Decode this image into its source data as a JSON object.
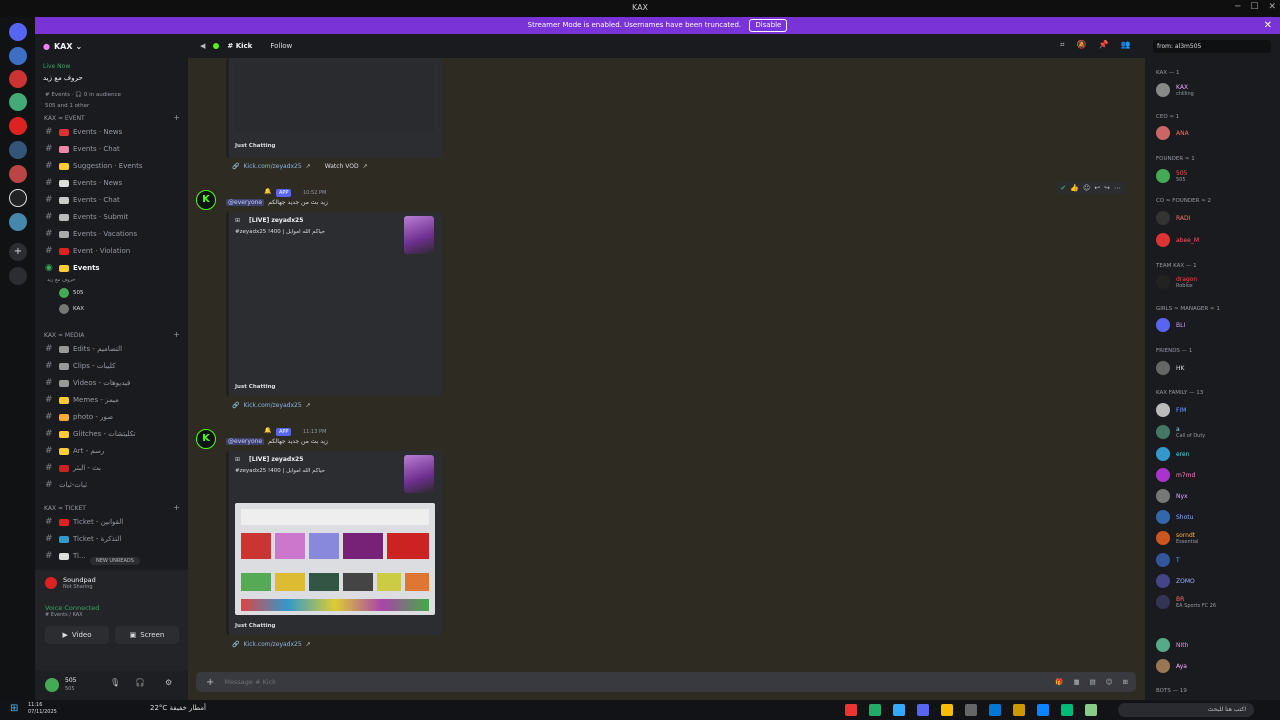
{
  "window": {
    "title": "KAX"
  },
  "banner": {
    "text": "Streamer Mode is enabled. Usernames have been truncated.",
    "button": "Disable"
  },
  "server": {
    "name": "KAX",
    "live_label": "Live Now",
    "live_title": "حروف مع زيد",
    "live_meta1": "# Events · 🎧 0 in audience",
    "live_meta2": "505 and 1 other"
  },
  "categories": [
    {
      "label": "KAX ≈ EVENT"
    },
    {
      "label": "KAX ≈ MEDIA"
    },
    {
      "label": "KAX ≈ TICKET"
    }
  ],
  "channels": {
    "event": [
      "Events · News",
      "Events · Chat",
      "Suggestion · Events",
      "Events · News",
      "Events · Chat",
      "Events · Submit",
      "Events · Vacations",
      "Event · Violation",
      "Events"
    ],
    "events_sub": [
      "505",
      "KAX"
    ],
    "events_sub_topic": "حروف مع زيد",
    "media": [
      "Edits - التصاميم",
      "Clips - كليبات",
      "Videos - فيديوهات",
      "Memes - ميمز",
      "photo - صور",
      "Glitches - تكليتشات",
      "Art - رسم",
      "بث - البثر",
      "ثبات-ثبات"
    ],
    "ticket": [
      "Ticket - القوانين",
      "Ticket - التذكرة",
      "Ti..."
    ]
  },
  "new_unreads": "NEW UNREADS",
  "voice": {
    "app": "Soundpad",
    "app_sub": "Not Sharing",
    "status": "Voice Connected",
    "status_sub": "# Events / KAX",
    "video": "Video",
    "screen": "Screen",
    "user": "505",
    "user_sub": "505"
  },
  "chat": {
    "channel": "# Kick",
    "follow": "Follow",
    "composer_placeholder": "Message # Kick",
    "messages": [
      {
        "time": "10:52 PM",
        "badge": "APP",
        "mention": "@everyone",
        "text": "زيد بث من جديد جهالكم",
        "embed_title": "[LIVE] zeyadx25",
        "embed_desc": "#zeyadx25 !400 | حياكم الله اموايل",
        "embed_foot": "Just Chatting",
        "link": "Kick.com/zeyadx25"
      },
      {
        "time": "11:13 PM",
        "badge": "APP",
        "mention": "@everyone",
        "text": "زيد بث من جديد جهالكم",
        "embed_title": "[LIVE] zeyadx25",
        "embed_desc": "#zeyadx25 !400 | حياكم الله اموايل",
        "embed_foot": "Just Chatting",
        "link": "Kick.com/zeyadx25"
      }
    ],
    "prev_embed_foot": "Just Chatting",
    "prev_link": "Kick.com/zeyadx25",
    "prev_vod": "Watch VOD"
  },
  "members": {
    "search": "from: al3m505",
    "groups": [
      "KAX — 1",
      "Ceo ≈ 1",
      "Founder ≈ 1",
      "Co ≈ Founder ≈ 2",
      "Team KAX — 1",
      "Girls ≈ Manager ≈ 1",
      "Friends — 1",
      "KAX Family — 13",
      "Bots — 19"
    ],
    "list": [
      {
        "name": "KAX",
        "sub": "chilling"
      },
      {
        "name": "ANA",
        "sub": ""
      },
      {
        "name": "505",
        "sub": "505"
      },
      {
        "name": "RADI",
        "sub": ""
      },
      {
        "name": "abee_M",
        "sub": ""
      },
      {
        "name": "dragon",
        "sub": "Roblox"
      },
      {
        "name": "BLI",
        "sub": ""
      },
      {
        "name": "HK",
        "sub": ""
      },
      {
        "name": "FIM",
        "sub": ""
      },
      {
        "name": "a",
        "sub": "Call of Duty"
      },
      {
        "name": "eren",
        "sub": ""
      },
      {
        "name": "m7md",
        "sub": ""
      },
      {
        "name": "Nyx",
        "sub": ""
      },
      {
        "name": "Shotu",
        "sub": ""
      },
      {
        "name": "sorndt",
        "sub": "Essential"
      },
      {
        "name": "T",
        "sub": ""
      },
      {
        "name": "ZOMO",
        "sub": ""
      },
      {
        "name": "BR",
        "sub": ""
      },
      {
        "name": "EA Sports FC 26",
        "sub": ""
      },
      {
        "name": "NIth",
        "sub": ""
      },
      {
        "name": "Aya",
        "sub": ""
      }
    ]
  },
  "taskbar": {
    "weather": "22°C أمطار خفيفة",
    "search": "اكتب هنا للبحث",
    "time": "11:16",
    "date": "07/11/2025"
  },
  "colors": {
    "accent": "#5865f2",
    "kick": "#53fc18",
    "banner": "#7a33d6"
  }
}
